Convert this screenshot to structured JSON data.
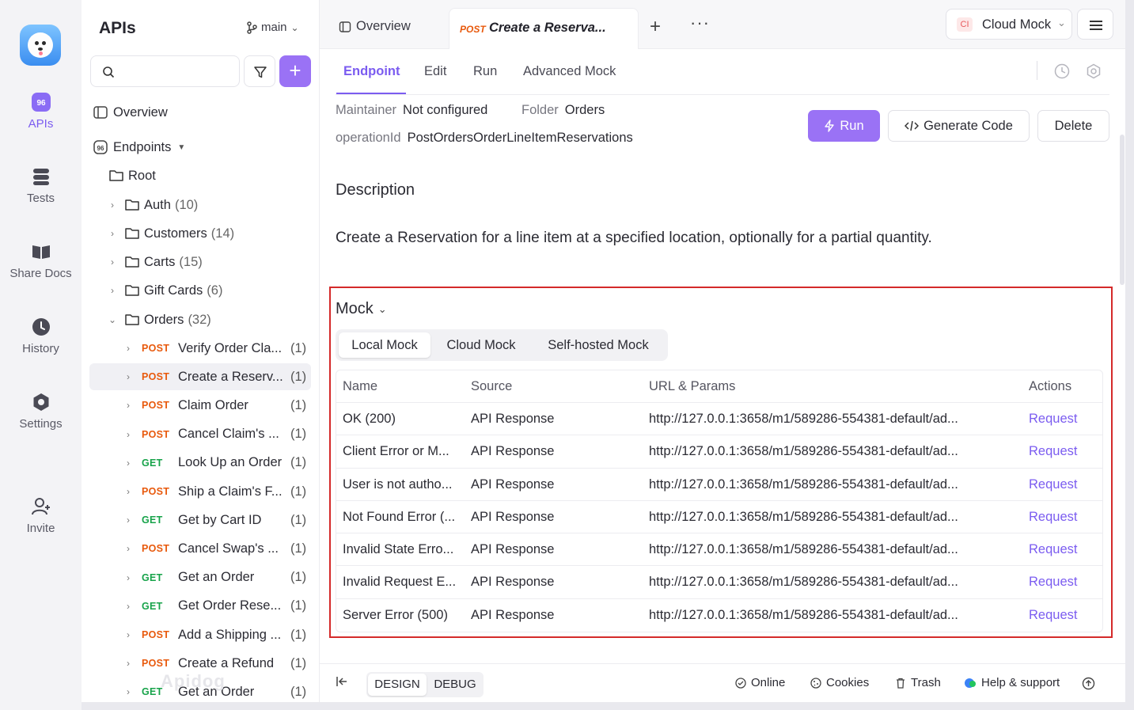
{
  "rail": {
    "items": [
      {
        "label": "APIs",
        "icon": "apis-icon",
        "active": true
      },
      {
        "label": "Tests",
        "icon": "tests-icon"
      },
      {
        "label": "Share Docs",
        "icon": "share-docs-icon"
      },
      {
        "label": "History",
        "icon": "history-icon"
      },
      {
        "label": "Settings",
        "icon": "settings-icon"
      },
      {
        "label": "Invite",
        "icon": "invite-icon"
      }
    ]
  },
  "sidebar": {
    "title": "APIs",
    "branch": "main",
    "overview_label": "Overview",
    "endpoints_label": "Endpoints",
    "root_label": "Root",
    "folders": [
      {
        "name": "Auth",
        "count": "(10)"
      },
      {
        "name": "Customers",
        "count": "(14)"
      },
      {
        "name": "Carts",
        "count": "(15)"
      },
      {
        "name": "Gift Cards",
        "count": "(6)"
      },
      {
        "name": "Orders",
        "count": "(32)"
      }
    ],
    "endpoints": [
      {
        "method": "POST",
        "name": "Verify Order Cla...",
        "count": "(1)"
      },
      {
        "method": "POST",
        "name": "Create a Reserv...",
        "count": "(1)",
        "selected": true
      },
      {
        "method": "POST",
        "name": "Claim Order",
        "count": "(1)"
      },
      {
        "method": "POST",
        "name": "Cancel Claim's ...",
        "count": "(1)"
      },
      {
        "method": "GET",
        "name": "Look Up an Order",
        "count": "(1)"
      },
      {
        "method": "POST",
        "name": "Ship a Claim's F...",
        "count": "(1)"
      },
      {
        "method": "GET",
        "name": "Get by Cart ID",
        "count": "(1)"
      },
      {
        "method": "POST",
        "name": "Cancel Swap's ...",
        "count": "(1)"
      },
      {
        "method": "GET",
        "name": "Get an Order",
        "count": "(1)"
      },
      {
        "method": "GET",
        "name": "Get Order Rese...",
        "count": "(1)"
      },
      {
        "method": "POST",
        "name": "Add a Shipping ...",
        "count": "(1)"
      },
      {
        "method": "POST",
        "name": "Create a Refund",
        "count": "(1)"
      },
      {
        "method": "GET",
        "name": "Get an Order",
        "count": "(1)"
      }
    ],
    "watermark": "Apidog"
  },
  "tabs": {
    "overview": "Overview",
    "active_method": "POST",
    "active_title": "Create a Reserva...",
    "env_badge": "CI",
    "env_label": "Cloud Mock"
  },
  "subtabs": [
    "Endpoint",
    "Edit",
    "Run",
    "Advanced Mock"
  ],
  "meta": {
    "maintainer_key": "Maintainer",
    "maintainer_val": "Not configured",
    "folder_key": "Folder",
    "folder_val": "Orders",
    "opid_key": "operationId",
    "opid_val": "PostOrdersOrderLineItemReservations"
  },
  "actions": {
    "run": "Run",
    "generate": "Generate Code",
    "delete": "Delete"
  },
  "description": {
    "title": "Description",
    "text": "Create a Reservation for a line item at a specified location, optionally for a partial quantity."
  },
  "mock": {
    "title": "Mock",
    "modes": [
      "Local Mock",
      "Cloud Mock",
      "Self-hosted Mock"
    ],
    "headers": [
      "Name",
      "Source",
      "URL & Params",
      "Actions"
    ],
    "rows": [
      {
        "name": "OK (200)",
        "source": "API Response",
        "url": "http://127.0.0.1:3658/m1/589286-554381-default/ad...",
        "action": "Request"
      },
      {
        "name": "Client Error or M...",
        "source": "API Response",
        "url": "http://127.0.0.1:3658/m1/589286-554381-default/ad...",
        "action": "Request"
      },
      {
        "name": "User is not autho...",
        "source": "API Response",
        "url": "http://127.0.0.1:3658/m1/589286-554381-default/ad...",
        "action": "Request"
      },
      {
        "name": "Not Found Error (...",
        "source": "API Response",
        "url": "http://127.0.0.1:3658/m1/589286-554381-default/ad...",
        "action": "Request"
      },
      {
        "name": "Invalid State Erro...",
        "source": "API Response",
        "url": "http://127.0.0.1:3658/m1/589286-554381-default/ad...",
        "action": "Request"
      },
      {
        "name": "Invalid Request E...",
        "source": "API Response",
        "url": "http://127.0.0.1:3658/m1/589286-554381-default/ad...",
        "action": "Request"
      },
      {
        "name": "Server Error (500)",
        "source": "API Response",
        "url": "http://127.0.0.1:3658/m1/589286-554381-default/ad...",
        "action": "Request"
      }
    ]
  },
  "footer": {
    "design": "DESIGN",
    "debug": "DEBUG",
    "online": "Online",
    "cookies": "Cookies",
    "trash": "Trash",
    "help": "Help & support"
  },
  "colors": {
    "accent": "#7b5cf0",
    "post": "#e8590c",
    "get": "#17a34a",
    "highlight": "#d42a2a"
  }
}
